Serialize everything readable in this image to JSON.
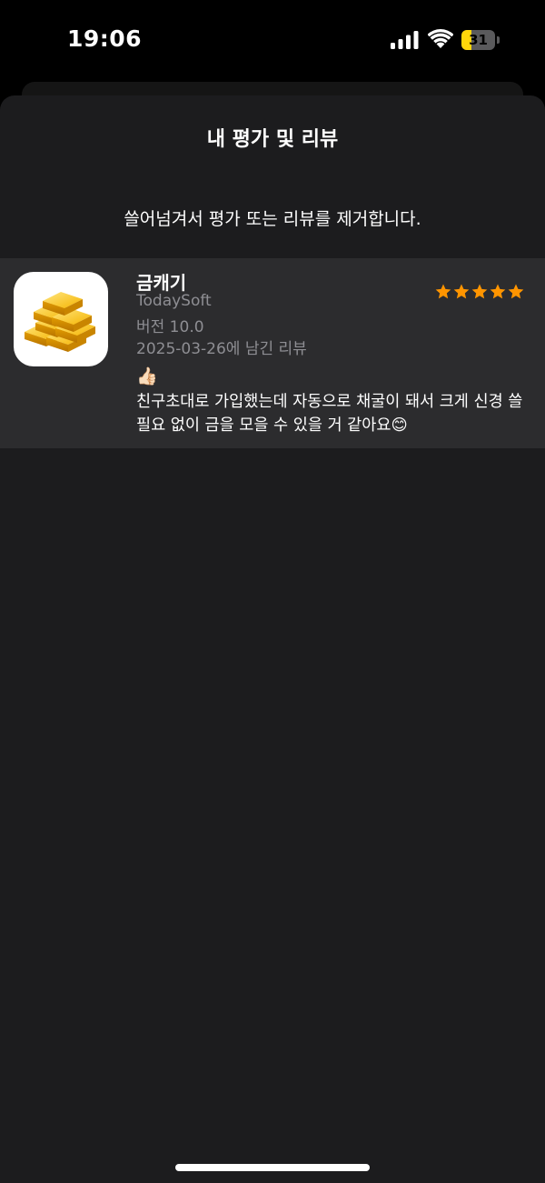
{
  "status_bar": {
    "time": "19:06",
    "battery_level": "31",
    "battery_percent": 31,
    "battery_color": "#ffd60a",
    "icons": [
      "signal-icon",
      "wifi-icon",
      "battery-icon"
    ]
  },
  "sheet": {
    "title": "내 평가 및 리뷰",
    "hint": "쓸어넘겨서 평가 또는 리뷰를 제거합니다."
  },
  "review": {
    "app_name": "금캐기",
    "developer": "TodaySoft",
    "version": "버전 10.0",
    "date": "2025-03-26에 남긴 리뷰",
    "rating": 5,
    "rating_max": 5,
    "star_color": "#ff9500",
    "title": "👍🏻",
    "body": "친구초대로 가입했는데 자동으로 채굴이 돼서 크게 신경 쓸 필요 없이 금을 모을 수 있을 거 같아요😊",
    "app_icon": "gold-bars-icon"
  },
  "theme": {
    "background": "#000000",
    "sheet_background": "#1c1c1e",
    "row_background": "#2c2c2e",
    "secondary_text": "#8e8e93"
  }
}
